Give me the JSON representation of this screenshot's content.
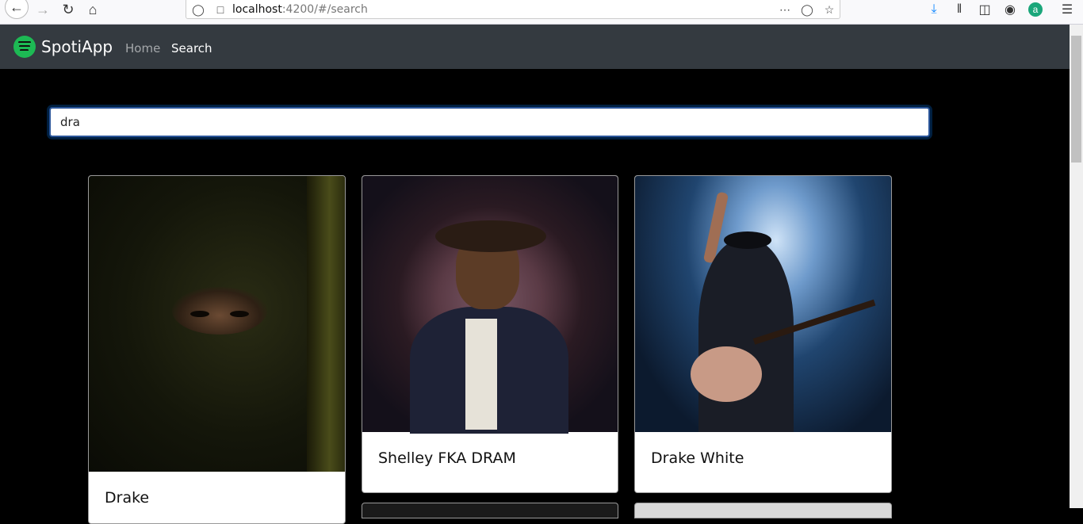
{
  "browser": {
    "url_host": "localhost",
    "url_path": ":4200/#/search"
  },
  "app": {
    "brand": "SpotiApp",
    "nav": {
      "home_label": "Home",
      "search_label": "Search"
    }
  },
  "search": {
    "value": "dra",
    "placeholder": ""
  },
  "artists": [
    {
      "name": "Drake"
    },
    {
      "name": "Shelley FKA DRAM"
    },
    {
      "name": "Drake White"
    }
  ],
  "colors": {
    "navbar": "#343a40",
    "spotify_green": "#1db954",
    "page_bg": "#000000"
  }
}
